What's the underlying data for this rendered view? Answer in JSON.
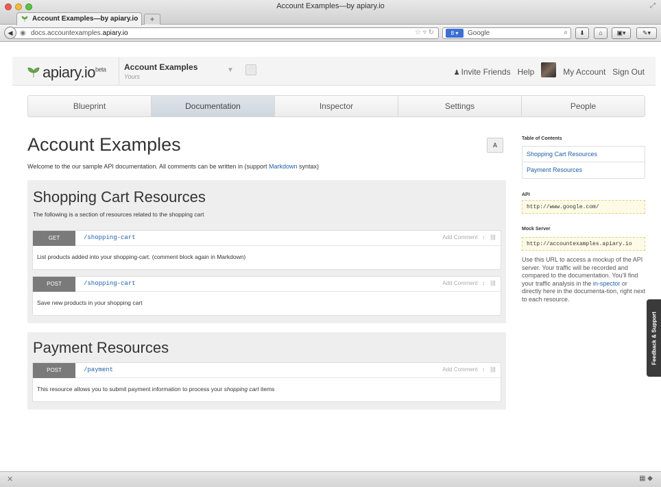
{
  "window": {
    "title": "Account Examples—by apiary.io",
    "tab_title": "Account Examples—by apiary.io",
    "tab_add": "+"
  },
  "navbar": {
    "url_prefix": "docs.accountexamples.",
    "url_domain": "apiary.io",
    "search_placeholder": "Google"
  },
  "app": {
    "logo_text": "apiary.io",
    "logo_beta": "beta",
    "project_name": "Account Examples",
    "project_owner": "Yours",
    "invite_friends": "Invite Friends",
    "help": "Help",
    "my_account": "My Account",
    "sign_out": "Sign Out"
  },
  "tabs": [
    {
      "label": "Blueprint"
    },
    {
      "label": "Documentation"
    },
    {
      "label": "Inspector"
    },
    {
      "label": "Settings"
    },
    {
      "label": "People"
    }
  ],
  "doc": {
    "title": "Account Examples",
    "desc_prefix": "Welcome to the our sample API documentation. All comments can be written in (support ",
    "desc_link": "Markdown",
    "desc_suffix": " syntax)",
    "avatar_letter": "A"
  },
  "sections": [
    {
      "title": "Shopping Cart Resources",
      "desc": "The following is a section of resources related to the shopping cart",
      "resources": [
        {
          "method": "GET",
          "path": "/shopping-cart",
          "actions": "Add Comment",
          "body": "List products added into your shopping-cart. (comment block again in Markdown)"
        },
        {
          "method": "POST",
          "path": "/shopping-cart",
          "actions": "Add Comment",
          "body": "Save new products in your shopping cart"
        }
      ]
    },
    {
      "title": "Payment Resources",
      "resources": [
        {
          "method": "POST",
          "path": "/payment",
          "actions": "Add Comment",
          "body_prefix": "This resource allows you to submit payment information to process your ",
          "body_em": "shopping cart",
          "body_suffix": " items"
        }
      ]
    }
  ],
  "sidebar": {
    "toc_label": "Table of Contents",
    "toc": [
      "Shopping Cart Resources",
      "Payment Resources"
    ],
    "api_label": "API",
    "api_url": "http://www.google.com/",
    "mock_label": "Mock Server",
    "mock_url": "http://accountexamples.apiary.io",
    "mock_note_1": "Use this URL to access a mockup of the API server. Your traffic will be recorded and compared to the documentation. You'll find your traffic analysis in the ",
    "mock_note_link1": "in-spector",
    "mock_note_2": " or directly here in the documenta-tion, right next to each resource."
  },
  "feedback": "Feedback & Support",
  "colors": {
    "link": "#1e5fa8",
    "method_bg": "#7a7a7a",
    "logo_green": "#6aa84f"
  }
}
